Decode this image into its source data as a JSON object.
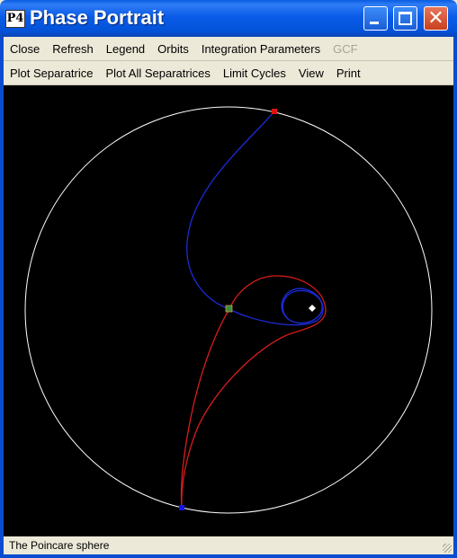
{
  "window": {
    "icon_text": "P4",
    "title": "Phase Portrait"
  },
  "menu_row1": [
    {
      "label": "Close",
      "enabled": true
    },
    {
      "label": "Refresh",
      "enabled": true
    },
    {
      "label": "Legend",
      "enabled": true
    },
    {
      "label": "Orbits",
      "enabled": true
    },
    {
      "label": "Integration Parameters",
      "enabled": true
    },
    {
      "label": "GCF",
      "enabled": false
    }
  ],
  "menu_row2": [
    {
      "label": "Plot Separatrice",
      "enabled": true
    },
    {
      "label": "Plot All Separatrices",
      "enabled": true
    },
    {
      "label": "Limit Cycles",
      "enabled": true
    },
    {
      "label": "View",
      "enabled": true
    },
    {
      "label": "Print",
      "enabled": true
    }
  ],
  "status": {
    "text": "The Poincare sphere"
  },
  "colors": {
    "background": "#000000",
    "boundary_circle": "#ffffff",
    "stable_separatrix": "#1c2ad8",
    "unstable_separatrix": "#d81c1c",
    "saddle_point": "#3c8a3c",
    "node_top": "#e01010",
    "node_bottom": "#1414e6",
    "focus": "#ffffff"
  }
}
